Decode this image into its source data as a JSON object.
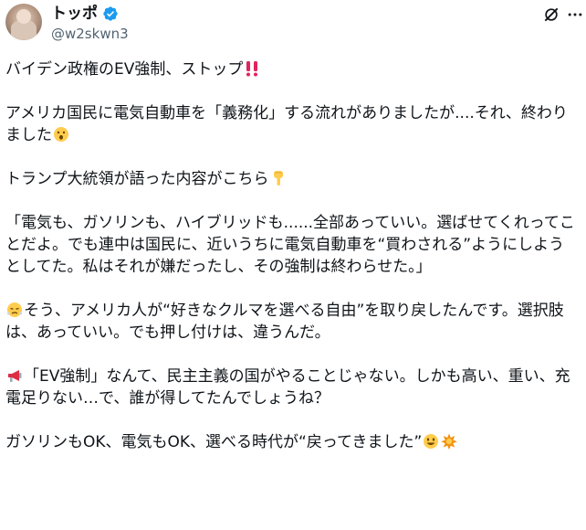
{
  "author": {
    "name": "トッポ",
    "handle": "@w2skwn3"
  },
  "post": {
    "line1": "バイデン政権のEV強制、ストップ",
    "line2": "アメリカ国民に電気自動車を「義務化」する流れがありましたが....それ、終わりました",
    "line3": "トランプ大統領が語った内容がこちら",
    "quote": "「電気も、ガソリンも、ハイブリッドも......全部あっていい。選ばせてくれってことだよ。でも連中は国民に、近いうちに電気自動車を“買わされる”ようにしようとしてた。私はそれが嫌だったし、その強制は終わらせた。」",
    "line5": "そう、アメリカ人が“好きなクルマを選べる自由”を取り戻したんです。選択肢は、あっていい。でも押し付けは、違うんだ。",
    "line6": "「EV強制」なんて、民主主義の国がやることじゃない。しかも高い、重い、充電足りない…で、誰が得してたんでしょうね？",
    "line7": "ガソリンもOK、電気もOK、選べる時代が“戻ってきました”"
  },
  "icons": {
    "verified": "verified-badge-icon",
    "grok": "grok-icon",
    "more": "more-icon",
    "e1": "double-exclamation-icon",
    "e2": "surprised-face-icon",
    "e3": "pointing-down-icon",
    "e4": "steam-face-icon",
    "e5": "megaphone-icon",
    "e6": "grinning-face-icon",
    "e7": "collision-icon"
  },
  "colors": {
    "text": "#0f1419",
    "secondary": "#536471",
    "verified": "#1d9bf0"
  }
}
